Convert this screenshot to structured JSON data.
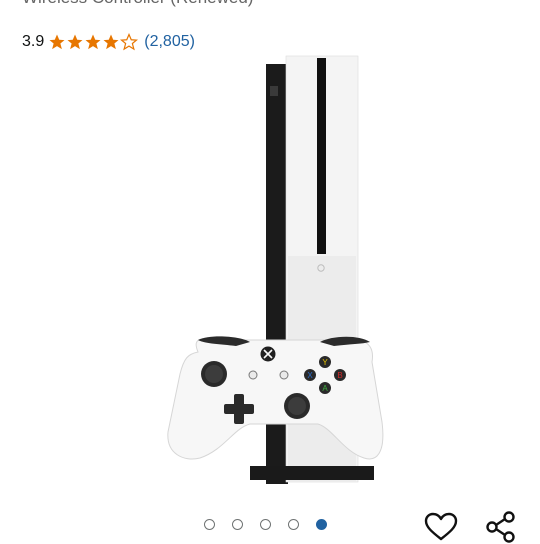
{
  "product": {
    "title": "Wireless Controller (Renewed)",
    "rating_value": "3.9",
    "rating_stars": 3.9,
    "review_count": "(2,805)"
  },
  "gallery": {
    "image_count": 5,
    "active_index": 4
  },
  "icons": {
    "star": "star-icon",
    "wishlist": "heart-icon",
    "share": "share-icon"
  },
  "colors": {
    "star": "#e77600",
    "link": "#2162a1",
    "active_dot": "#2162a1"
  }
}
